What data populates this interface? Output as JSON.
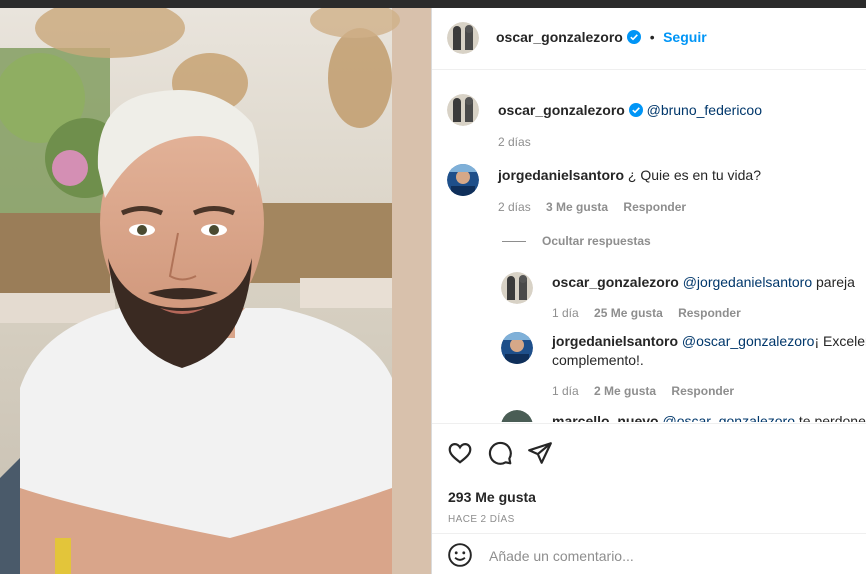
{
  "header": {
    "username": "oscar_gonzalezoro",
    "separator": "•",
    "follow_label": "Seguir"
  },
  "caption": {
    "username": "oscar_gonzalezoro",
    "text": "@bruno_federicoo",
    "time": "2 días"
  },
  "comments": [
    {
      "username": "jorgedanielsantoro",
      "text": "¿ Quie es en tu vida?",
      "time": "2 días",
      "likes": "3 Me gusta",
      "reply_label": "Responder",
      "hide_replies_label": "Ocultar respuestas",
      "replies": [
        {
          "username": "oscar_gonzalezoro",
          "mention": "@jorgedanielsantoro",
          "text": "pareja",
          "time": "1 día",
          "likes": "25 Me gusta",
          "reply_label": "Responder"
        },
        {
          "username": "jorgedanielsantoro",
          "mention": "@oscar_gonzalezoro",
          "text": "¡ Excelente",
          "text2": "complemento!.",
          "time": "1 día",
          "likes": "2 Me gusta",
          "reply_label": "Responder"
        },
        {
          "username": "marcello_nuevo",
          "mention": "@oscar_gonzalezoro",
          "text": "te perdone"
        }
      ]
    }
  ],
  "actions": {
    "icons": [
      "heart-icon",
      "comment-icon",
      "share-icon"
    ],
    "likes": "293 Me gusta",
    "posted_ago": "HACE 2 DÍAS"
  },
  "composer": {
    "placeholder": "Añade un comentario..."
  },
  "colors": {
    "accent": "#0095f6",
    "verified": "#0095f6",
    "mention": "#00376b",
    "muted": "#8e8e8e"
  }
}
